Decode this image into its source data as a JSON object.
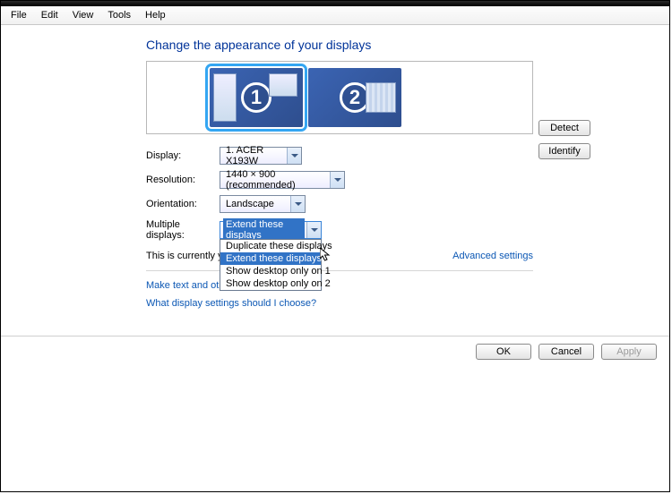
{
  "menubar": {
    "items": [
      "File",
      "Edit",
      "View",
      "Tools",
      "Help"
    ]
  },
  "page": {
    "title": "Change the appearance of your displays"
  },
  "monitors": {
    "num1": "1",
    "num2": "2"
  },
  "buttons": {
    "detect": "Detect",
    "identify": "Identify",
    "ok": "OK",
    "cancel": "Cancel",
    "apply": "Apply"
  },
  "labels": {
    "display": "Display:",
    "resolution": "Resolution:",
    "orientation": "Orientation:",
    "multiple": "Multiple displays:"
  },
  "values": {
    "display": "1. ACER X193W",
    "resolution": "1440 × 900 (recommended)",
    "orientation": "Landscape",
    "multiple": "Extend these displays"
  },
  "multiple_options": [
    "Duplicate these displays",
    "Extend these displays",
    "Show desktop only on 1",
    "Show desktop only on 2"
  ],
  "multiple_highlight_index": 1,
  "status": {
    "main_monitor_text": "This is currently you",
    "advanced": "Advanced settings"
  },
  "links": {
    "make_text": "Make text and othe",
    "which_settings": "What display settings should I choose?"
  }
}
